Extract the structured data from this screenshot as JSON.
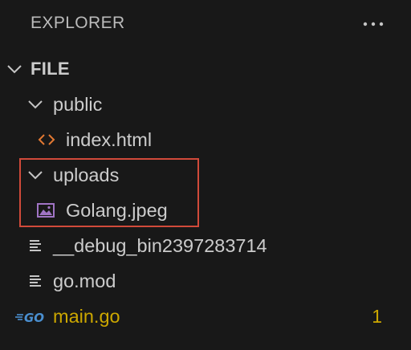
{
  "header": {
    "title": "EXPLORER",
    "more_icon": "ellipsis-icon"
  },
  "tree": {
    "root": {
      "label": "FILE",
      "expanded": true,
      "icon": "chevron-down-icon"
    },
    "items": [
      {
        "label": "public",
        "type": "folder",
        "expanded": true,
        "icon": "chevron-down-icon"
      },
      {
        "label": "index.html",
        "type": "file",
        "icon": "html-code-icon"
      },
      {
        "label": "uploads",
        "type": "folder",
        "expanded": true,
        "icon": "chevron-down-icon"
      },
      {
        "label": "Golang.jpeg",
        "type": "file",
        "icon": "image-file-icon"
      },
      {
        "label": "__debug_bin2397283714",
        "type": "file",
        "icon": "text-lines-icon"
      },
      {
        "label": "go.mod",
        "type": "file",
        "icon": "text-lines-icon"
      },
      {
        "label": "main.go",
        "type": "file",
        "icon": "go-gopher-icon",
        "icon_text": "GO",
        "problems": "1"
      }
    ]
  },
  "colors": {
    "background": "#181818",
    "text": "#cccccc",
    "warning": "#cca700",
    "go_icon": "#4a8fd0",
    "html_icon": "#e37933",
    "image_icon": "#a074c4",
    "highlight_box": "#d14a3a"
  }
}
